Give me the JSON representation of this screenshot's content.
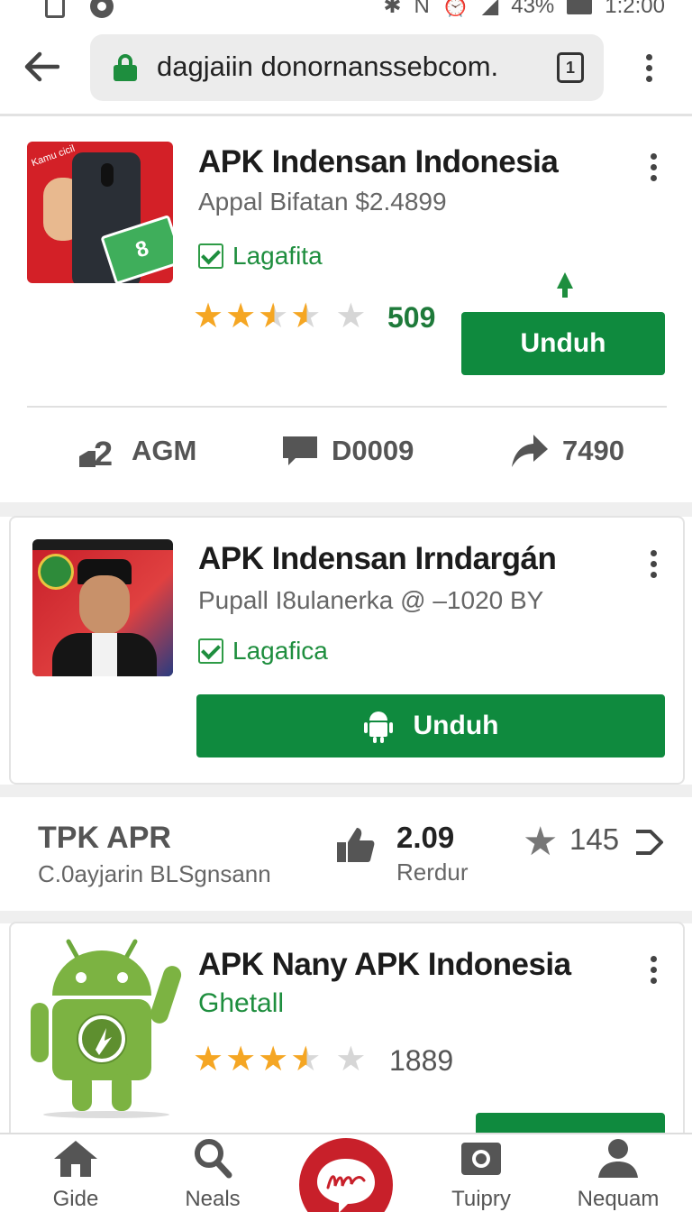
{
  "status_bar": {
    "battery": "43%",
    "time": "1:2:00"
  },
  "browser": {
    "url": "dagjaiin donornanssebcom."
  },
  "cards": [
    {
      "title": "APK Indensan Indonesia",
      "subtitle": "Appal Bifatan $2.4899",
      "verified_label": "Lagafita",
      "rating_stars": 3.5,
      "rating_count": "509",
      "button_label": "Unduh",
      "thumb_tag": "Kamu cicil",
      "thumb_cash": "8"
    },
    {
      "title": "APK Indensan Irndargán",
      "subtitle": "Pupall I8ulanerka @ –1020 BY",
      "verified_label": "Lagafica",
      "button_label": "Unduh"
    },
    {
      "title": "APK Nany APK Indonesia",
      "subtitle": "Ghetall",
      "rating_stars": 3.5,
      "rating_count": "1889"
    }
  ],
  "stats_row": [
    {
      "icon": "person-add-icon",
      "value": "AGM"
    },
    {
      "icon": "comment-icon",
      "value": "D0009"
    },
    {
      "icon": "share-icon",
      "value": "7490"
    }
  ],
  "info_row": {
    "title": "TPK APR",
    "subtitle": "C.0ayjarin BLSgnsann",
    "likes_value": "2.09",
    "likes_label": "Rerdur",
    "star_count": "145"
  },
  "bottom_nav": [
    {
      "label": "Gide",
      "icon": "home-icon"
    },
    {
      "label": "Neals",
      "icon": "search-icon"
    },
    {
      "label": "Tuipry",
      "icon": "camera-icon"
    },
    {
      "label": "Nequam",
      "icon": "profile-icon"
    }
  ],
  "colors": {
    "accent": "#0f8a3e",
    "star": "#f5a623",
    "brand": "#c8202a"
  }
}
